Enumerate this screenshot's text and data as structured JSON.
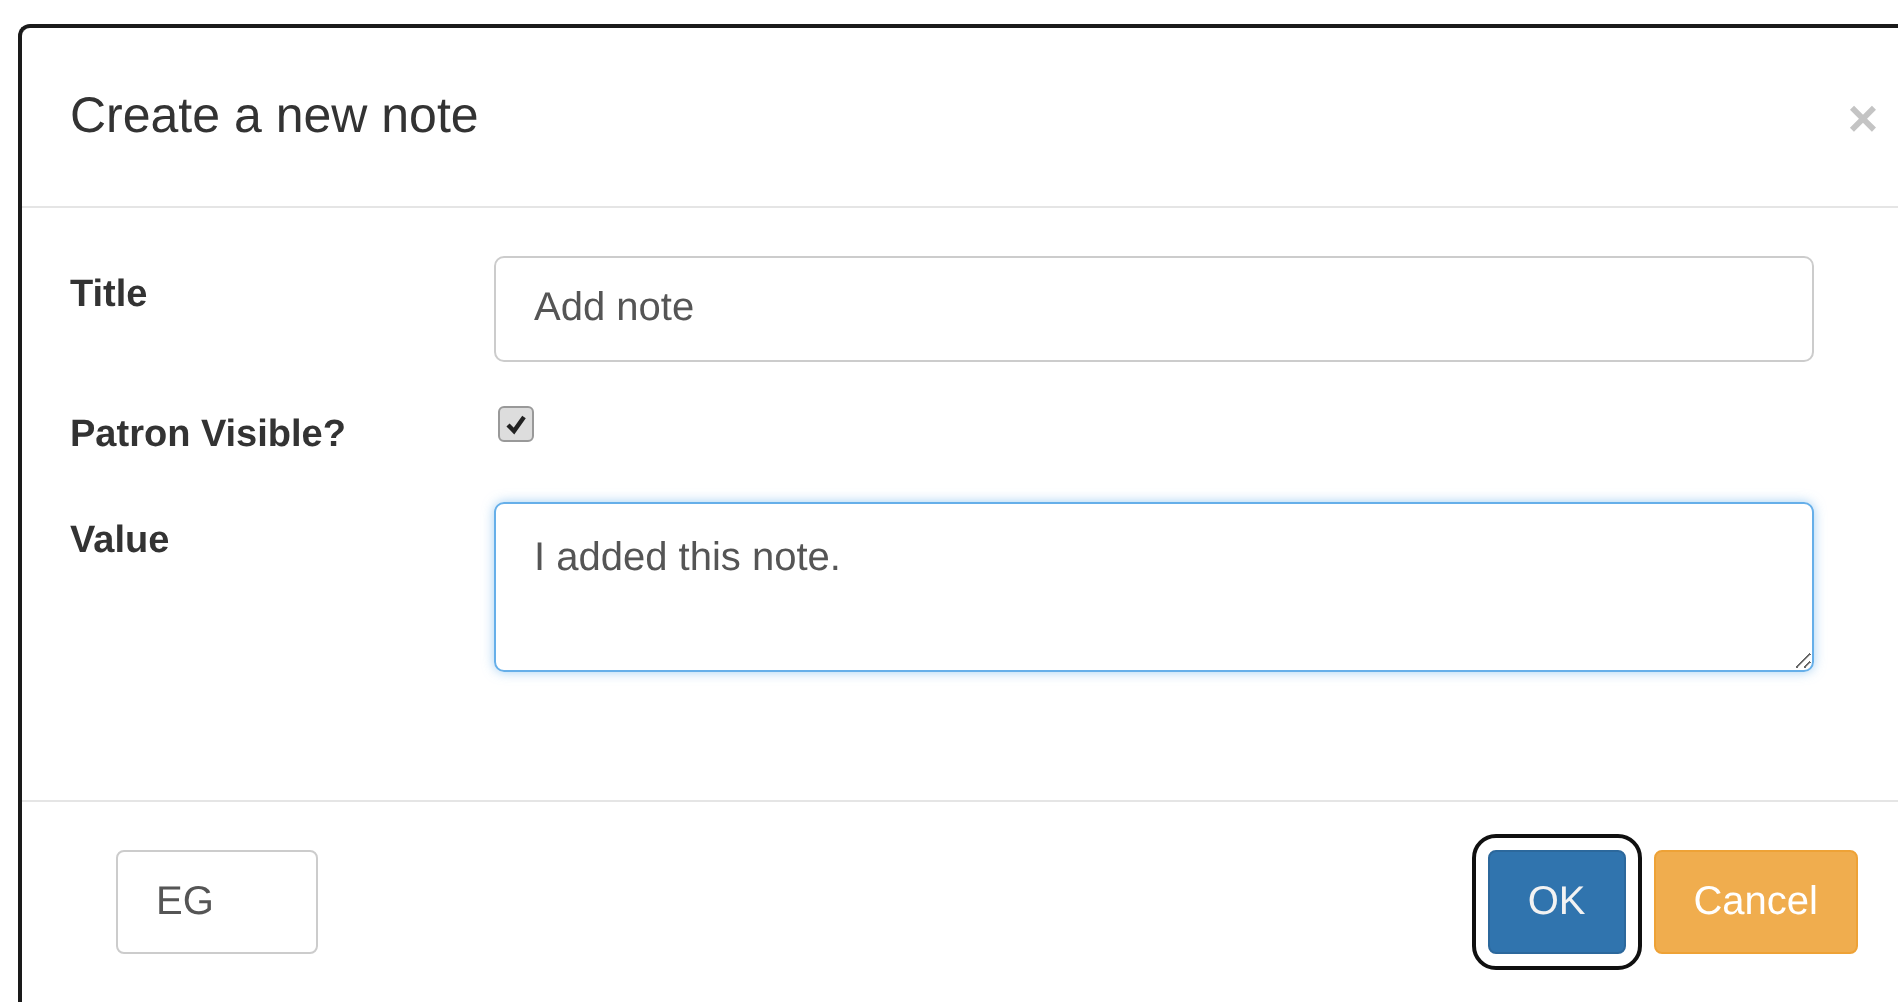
{
  "dialog": {
    "title": "Create a new note",
    "close": "×"
  },
  "fields": [
    {
      "kind": "text",
      "label": "Title",
      "value": "Add note",
      "focused": false
    },
    {
      "kind": "checkbox",
      "label": "Patron Visible?",
      "checked": true
    },
    {
      "kind": "textarea",
      "label": "Value",
      "value": "I added this note.",
      "focused": true
    }
  ],
  "footer": {
    "code_field": {
      "value": "EG"
    },
    "buttons": [
      {
        "label": "OK",
        "kind": "primary",
        "focused": true
      },
      {
        "label": "Cancel",
        "kind": "warning",
        "focused": false
      }
    ]
  }
}
